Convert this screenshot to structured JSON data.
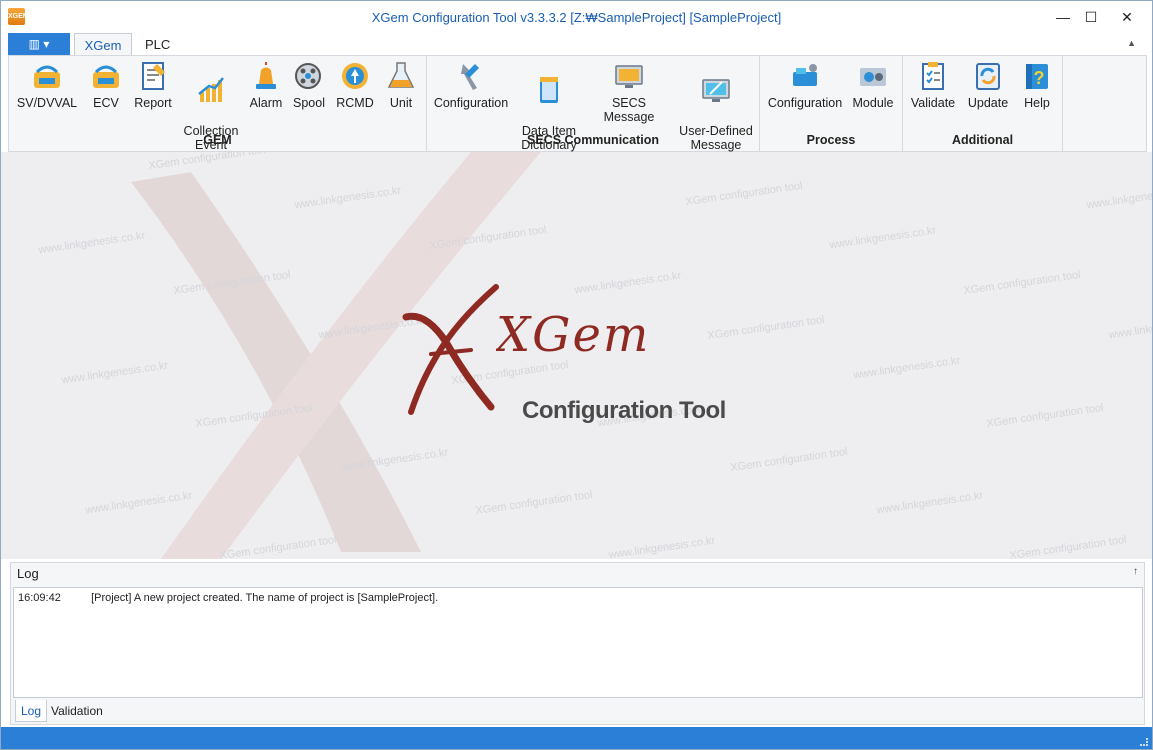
{
  "window": {
    "app_icon_text": "XGEM",
    "title": "XGem Configuration Tool v3.3.3.2 [Z:₩SampleProject] [SampleProject]",
    "minimize": "—",
    "maximize": "☐",
    "close": "✕"
  },
  "ribbon_tabs": {
    "file_menu": "▥ ▾",
    "tabs": [
      "XGem",
      "PLC"
    ],
    "collapse": "▲"
  },
  "ribbon": {
    "groups": [
      {
        "label": "GEM",
        "buttons": [
          {
            "label": "SV/DVVAL",
            "icon": "sv-dvval-icon"
          },
          {
            "label": "ECV",
            "icon": "ecv-icon"
          },
          {
            "label": "Report",
            "icon": "report-icon"
          },
          {
            "label": "Collection\nEvent",
            "icon": "collection-event-icon"
          },
          {
            "label": "Alarm",
            "icon": "alarm-icon"
          },
          {
            "label": "Spool",
            "icon": "spool-icon"
          },
          {
            "label": "RCMD",
            "icon": "rcmd-icon"
          },
          {
            "label": "Unit",
            "icon": "unit-icon"
          }
        ]
      },
      {
        "label": "SECS Communication",
        "buttons": [
          {
            "label": "Configuration",
            "icon": "secs-configuration-icon"
          },
          {
            "label": "Data Item\nDictionary",
            "icon": "data-item-dictionary-icon"
          },
          {
            "label": "SECS Message",
            "icon": "secs-message-icon"
          },
          {
            "label": "User-Defined\nMessage",
            "icon": "user-defined-message-icon"
          }
        ]
      },
      {
        "label": "Process",
        "buttons": [
          {
            "label": "Configuration",
            "icon": "process-configuration-icon"
          },
          {
            "label": "Module",
            "icon": "module-icon"
          }
        ]
      },
      {
        "label": "Additional",
        "buttons": [
          {
            "label": "Validate",
            "icon": "validate-icon"
          },
          {
            "label": "Update",
            "icon": "update-icon"
          },
          {
            "label": "Help",
            "icon": "help-icon"
          }
        ]
      }
    ]
  },
  "main": {
    "logo_text": "XGem",
    "logo_subtitle": "Configuration Tool",
    "watermarks": [
      "www.linkgenesis.co.kr",
      "XGem configuration tool"
    ]
  },
  "log": {
    "title": "Log",
    "pin": "↑",
    "entries": [
      {
        "time": "16:09:42",
        "message": "[Project] A new project created. The name of project is [SampleProject]."
      }
    ],
    "tabs": [
      "Log",
      "Validation Result"
    ]
  },
  "colors": {
    "accent": "#2b7fd6",
    "title_text": "#1a5fb4",
    "logo_red": "#8e2a22",
    "ribbon_bg": "#f5f6f7",
    "workspace_bg": "#eeeef1"
  }
}
